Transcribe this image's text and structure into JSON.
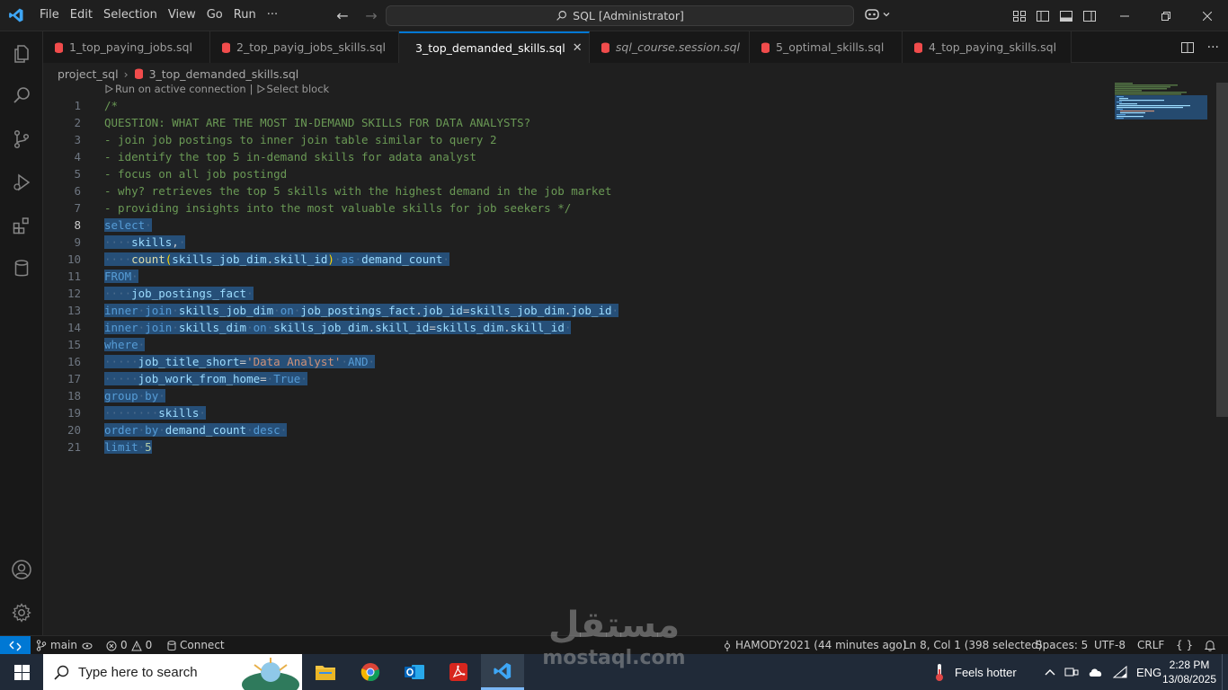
{
  "menu": [
    "File",
    "Edit",
    "Selection",
    "View",
    "Go",
    "Run",
    "···"
  ],
  "command_center": {
    "label": "SQL [Administrator]"
  },
  "tabs": [
    {
      "label": "1_top_paying_jobs.sql",
      "active": false,
      "italic": false
    },
    {
      "label": "2_top_payig_jobs_skills.sql",
      "active": false,
      "italic": false
    },
    {
      "label": "3_top_demanded_skills.sql",
      "active": true,
      "italic": false
    },
    {
      "label": "sql_course.session.sql",
      "active": false,
      "italic": true
    },
    {
      "label": "5_optimal_skills.sql",
      "active": false,
      "italic": false
    },
    {
      "label": "4_top_paying_skills.sql",
      "active": false,
      "italic": false
    }
  ],
  "breadcrumb": {
    "folder": "project_sql",
    "file": "3_top_demanded_skills.sql"
  },
  "codelens": {
    "run": "Run on active connection",
    "sep": "|",
    "select": "Select block"
  },
  "editor": {
    "current_line": 8,
    "lines": [
      "/*",
      "QUESTION: WHAT ARE THE MOST IN-DEMAND SKILLS FOR DATA ANALYSTS?",
      "- join job postings to inner join table similar to query 2",
      "- identify the top 5 in-demand skills for adata analyst",
      "- focus on all job postingd",
      "- why? retrieves the top 5 skills with the highest demand in the job market",
      "- providing insights into the most valuable skills for job seekers */",
      "select",
      "    skills,",
      "    count(skills_job_dim.skill_id) as demand_count",
      "FROM",
      "    job_postings_fact",
      "inner join skills_job_dim on job_postings_fact.job_id=skills_job_dim.job_id",
      "inner join skills_dim on skills_job_dim.skill_id=skills_dim.skill_id",
      "where",
      "     job_title_short='Data Analyst' AND",
      "     job_work_from_home= True",
      "group by",
      "        skills",
      "order by demand_count desc",
      "limit 5"
    ]
  },
  "statusbar": {
    "branch": "main",
    "errors": "0",
    "warnings": "0",
    "connect": "Connect",
    "blame": "HAMODY2021 (44 minutes ago)",
    "position": "Ln 8, Col 1 (398 selected)",
    "spaces": "Spaces: 5",
    "encoding": "UTF-8",
    "eol": "CRLF",
    "language": "{ }"
  },
  "taskbar": {
    "search_placeholder": "Type here to search",
    "weather": "Feels hotter",
    "language": "ENG",
    "time": "2:28 PM",
    "date": "13/08/2025"
  },
  "watermark": {
    "arabic": "مستقل",
    "latin": "mostaql.com"
  },
  "colors": {
    "accent": "#0078d4",
    "selection": "#264f78",
    "comment": "#6a9955",
    "keyword": "#569cd6",
    "string": "#ce9178",
    "tab_icon": "#f14c4c"
  }
}
